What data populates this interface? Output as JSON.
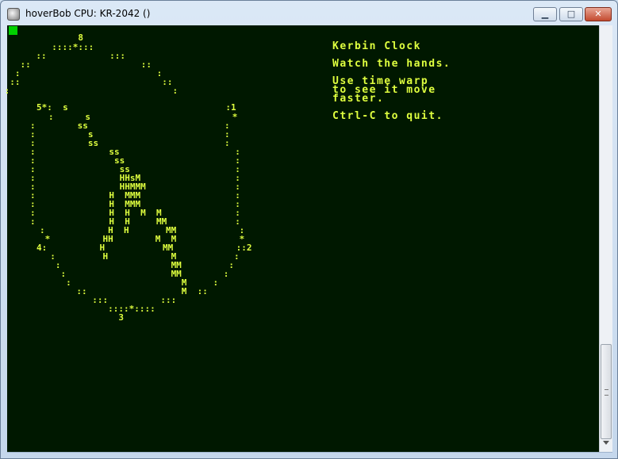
{
  "window": {
    "title": "hoverBob CPU: KR-2042 ()"
  },
  "controls": {
    "minimize": "▁",
    "maximize": "□",
    "close": "✕"
  },
  "clock_rows": [
    "               8",
    "          ::::*:::",
    "       ::            :::",
    "    ::                     ::",
    "   :                          :",
    "  ::                           ::",
    " :                               :",
    "5*:  s                              :1",
    ":      s                           *",
    ":        ss                          :",
    ":          s                         :",
    ":          ss                        :",
    ":              ss                      :",
    ":               ss                     :",
    ":                ss                    :",
    ":                HHsM                  :",
    ":                HHMMM                 :",
    ":              H  MMM                  :",
    ":              H  MMM                  :",
    ":              H  H  M  M              :",
    ":              H  H     MM             :",
    ":            H  H       MM            :",
    " *          HH        M  M            *",
    "4:          H           MM            ::2",
    "  :         H            M           :",
    "   :                     MM         :",
    "    :                    MM        :",
    "     :                     M     :",
    "       ::                  M  ::",
    "          :::          :::",
    "             ::::*::::",
    "               3"
  ],
  "info": {
    "title": "Kerbin Clock",
    "line1": "Watch the hands.",
    "line2": "Use time warp",
    "line3": "to see it move",
    "line4": "faster.",
    "line5": "Ctrl-C to quit."
  },
  "colors": {
    "terminal_bg": "#001800",
    "terminal_fg": "#dfff3f",
    "cursor": "#00d000"
  }
}
